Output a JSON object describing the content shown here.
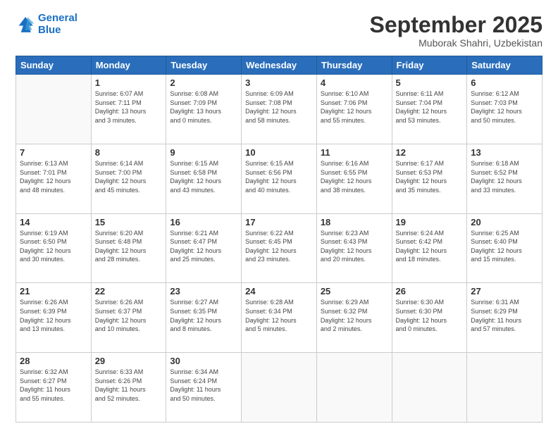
{
  "logo": {
    "line1": "General",
    "line2": "Blue"
  },
  "header": {
    "month": "September 2025",
    "location": "Muborak Shahri, Uzbekistan"
  },
  "weekdays": [
    "Sunday",
    "Monday",
    "Tuesday",
    "Wednesday",
    "Thursday",
    "Friday",
    "Saturday"
  ],
  "weeks": [
    [
      {
        "day": "",
        "info": ""
      },
      {
        "day": "1",
        "info": "Sunrise: 6:07 AM\nSunset: 7:11 PM\nDaylight: 13 hours\nand 3 minutes."
      },
      {
        "day": "2",
        "info": "Sunrise: 6:08 AM\nSunset: 7:09 PM\nDaylight: 13 hours\nand 0 minutes."
      },
      {
        "day": "3",
        "info": "Sunrise: 6:09 AM\nSunset: 7:08 PM\nDaylight: 12 hours\nand 58 minutes."
      },
      {
        "day": "4",
        "info": "Sunrise: 6:10 AM\nSunset: 7:06 PM\nDaylight: 12 hours\nand 55 minutes."
      },
      {
        "day": "5",
        "info": "Sunrise: 6:11 AM\nSunset: 7:04 PM\nDaylight: 12 hours\nand 53 minutes."
      },
      {
        "day": "6",
        "info": "Sunrise: 6:12 AM\nSunset: 7:03 PM\nDaylight: 12 hours\nand 50 minutes."
      }
    ],
    [
      {
        "day": "7",
        "info": "Sunrise: 6:13 AM\nSunset: 7:01 PM\nDaylight: 12 hours\nand 48 minutes."
      },
      {
        "day": "8",
        "info": "Sunrise: 6:14 AM\nSunset: 7:00 PM\nDaylight: 12 hours\nand 45 minutes."
      },
      {
        "day": "9",
        "info": "Sunrise: 6:15 AM\nSunset: 6:58 PM\nDaylight: 12 hours\nand 43 minutes."
      },
      {
        "day": "10",
        "info": "Sunrise: 6:15 AM\nSunset: 6:56 PM\nDaylight: 12 hours\nand 40 minutes."
      },
      {
        "day": "11",
        "info": "Sunrise: 6:16 AM\nSunset: 6:55 PM\nDaylight: 12 hours\nand 38 minutes."
      },
      {
        "day": "12",
        "info": "Sunrise: 6:17 AM\nSunset: 6:53 PM\nDaylight: 12 hours\nand 35 minutes."
      },
      {
        "day": "13",
        "info": "Sunrise: 6:18 AM\nSunset: 6:52 PM\nDaylight: 12 hours\nand 33 minutes."
      }
    ],
    [
      {
        "day": "14",
        "info": "Sunrise: 6:19 AM\nSunset: 6:50 PM\nDaylight: 12 hours\nand 30 minutes."
      },
      {
        "day": "15",
        "info": "Sunrise: 6:20 AM\nSunset: 6:48 PM\nDaylight: 12 hours\nand 28 minutes."
      },
      {
        "day": "16",
        "info": "Sunrise: 6:21 AM\nSunset: 6:47 PM\nDaylight: 12 hours\nand 25 minutes."
      },
      {
        "day": "17",
        "info": "Sunrise: 6:22 AM\nSunset: 6:45 PM\nDaylight: 12 hours\nand 23 minutes."
      },
      {
        "day": "18",
        "info": "Sunrise: 6:23 AM\nSunset: 6:43 PM\nDaylight: 12 hours\nand 20 minutes."
      },
      {
        "day": "19",
        "info": "Sunrise: 6:24 AM\nSunset: 6:42 PM\nDaylight: 12 hours\nand 18 minutes."
      },
      {
        "day": "20",
        "info": "Sunrise: 6:25 AM\nSunset: 6:40 PM\nDaylight: 12 hours\nand 15 minutes."
      }
    ],
    [
      {
        "day": "21",
        "info": "Sunrise: 6:26 AM\nSunset: 6:39 PM\nDaylight: 12 hours\nand 13 minutes."
      },
      {
        "day": "22",
        "info": "Sunrise: 6:26 AM\nSunset: 6:37 PM\nDaylight: 12 hours\nand 10 minutes."
      },
      {
        "day": "23",
        "info": "Sunrise: 6:27 AM\nSunset: 6:35 PM\nDaylight: 12 hours\nand 8 minutes."
      },
      {
        "day": "24",
        "info": "Sunrise: 6:28 AM\nSunset: 6:34 PM\nDaylight: 12 hours\nand 5 minutes."
      },
      {
        "day": "25",
        "info": "Sunrise: 6:29 AM\nSunset: 6:32 PM\nDaylight: 12 hours\nand 2 minutes."
      },
      {
        "day": "26",
        "info": "Sunrise: 6:30 AM\nSunset: 6:30 PM\nDaylight: 12 hours\nand 0 minutes."
      },
      {
        "day": "27",
        "info": "Sunrise: 6:31 AM\nSunset: 6:29 PM\nDaylight: 11 hours\nand 57 minutes."
      }
    ],
    [
      {
        "day": "28",
        "info": "Sunrise: 6:32 AM\nSunset: 6:27 PM\nDaylight: 11 hours\nand 55 minutes."
      },
      {
        "day": "29",
        "info": "Sunrise: 6:33 AM\nSunset: 6:26 PM\nDaylight: 11 hours\nand 52 minutes."
      },
      {
        "day": "30",
        "info": "Sunrise: 6:34 AM\nSunset: 6:24 PM\nDaylight: 11 hours\nand 50 minutes."
      },
      {
        "day": "",
        "info": ""
      },
      {
        "day": "",
        "info": ""
      },
      {
        "day": "",
        "info": ""
      },
      {
        "day": "",
        "info": ""
      }
    ]
  ]
}
